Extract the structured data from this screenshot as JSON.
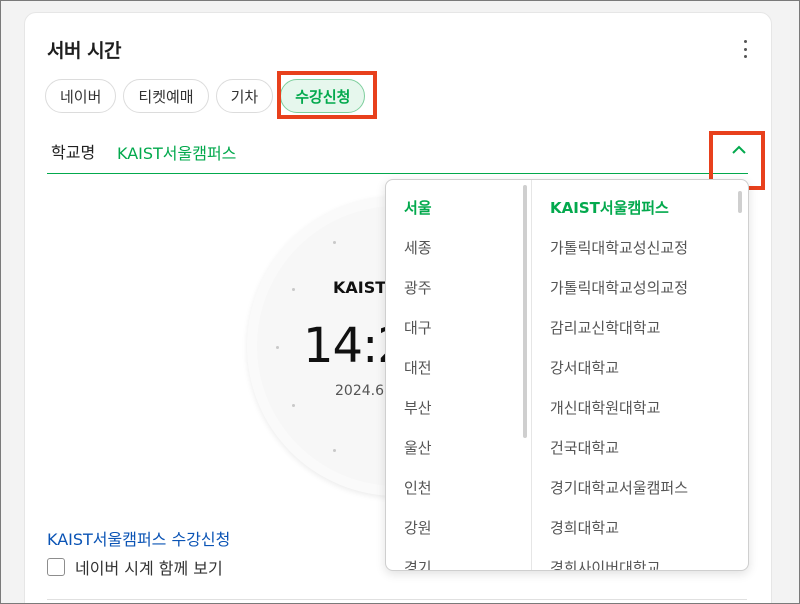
{
  "widget": {
    "title": "서버 시간",
    "tabs": [
      {
        "label": "네이버"
      },
      {
        "label": "티켓예매"
      },
      {
        "label": "기차"
      },
      {
        "label": "수강신청"
      }
    ],
    "active_tab": "수강신청",
    "school": {
      "label": "학교명",
      "value": "KAIST서울캠퍼스"
    },
    "clock": {
      "name": "KAIST서울캠퍼스",
      "time": "14:2",
      "date": "2024.6."
    },
    "link_text": "KAIST서울캠퍼스 수강신청",
    "checkbox_label": "네이버 시계 함께 보기",
    "checkbox_checked": false
  },
  "dropdown": {
    "regions": [
      "서울",
      "세종",
      "광주",
      "대구",
      "대전",
      "부산",
      "울산",
      "인천",
      "강원",
      "경기"
    ],
    "selected_region": "서울",
    "schools": [
      "KAIST서울캠퍼스",
      "가톨릭대학교성신교정",
      "가톨릭대학교성의교정",
      "감리교신학대학교",
      "강서대학교",
      "개신대학원대학교",
      "건국대학교",
      "경기대학교서울캠퍼스",
      "경희대학교",
      "경희사이버대학교"
    ],
    "selected_school": "KAIST서울캠퍼스"
  },
  "colors": {
    "accent_green": "#03a94d",
    "link_blue": "#0b54b5",
    "highlight_red": "#e8401c"
  },
  "icons": {
    "menu": "kebab-icon",
    "toggle": "chevron-up-icon"
  }
}
